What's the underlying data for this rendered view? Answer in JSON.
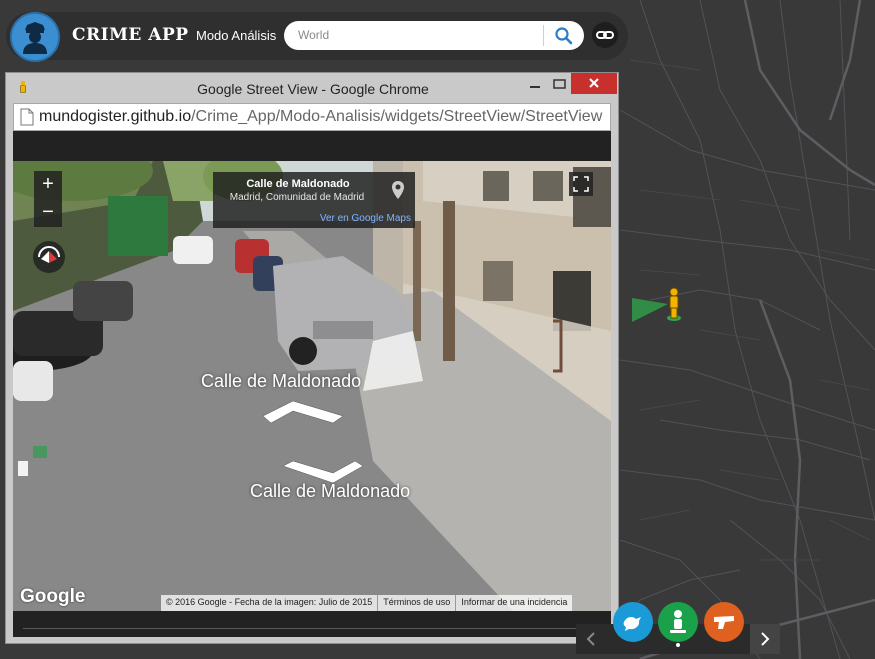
{
  "app": {
    "title": "CRIME APP",
    "mode_label": "Modo Análisis",
    "search_placeholder": "World",
    "icons": {
      "avatar": "police-officer-icon",
      "search": "magnifier-icon",
      "link": "link-icon"
    }
  },
  "window": {
    "title": "Google Street View - Google Chrome",
    "url_host": "mundogister.github.io",
    "url_path": "/Crime_App/Modo-Analisis/widgets/StreetView/StreetView"
  },
  "streetview": {
    "location_title": "Calle de Maldonado",
    "location_subtitle": "Madrid, Comunidad de Madrid",
    "maps_link": "Ver en Google Maps",
    "street_label_top": "Calle de Maldonado",
    "street_label_bottom": "Calle de Maldonado",
    "zoom_in": "+",
    "zoom_out": "−",
    "logo": "Google",
    "attribution": {
      "copyright": "© 2016 Google - Fecha de la imagen: Julio de 2015",
      "terms": "Términos de uso",
      "report": "Informar de una incidencia"
    }
  },
  "colors": {
    "map_bg": "#3a3a3b",
    "topbar_bg": "#2f2f30",
    "accent_blue": "#3b8fd0",
    "close_red": "#c7302c",
    "btn_blue": "#1a9ad6",
    "btn_green": "#1aa14a",
    "btn_orange": "#e0601f"
  },
  "widget_buttons": [
    {
      "name": "blue",
      "icon": "bird-icon"
    },
    {
      "name": "green",
      "icon": "person-icon"
    },
    {
      "name": "orange",
      "icon": "gun-icon"
    }
  ]
}
